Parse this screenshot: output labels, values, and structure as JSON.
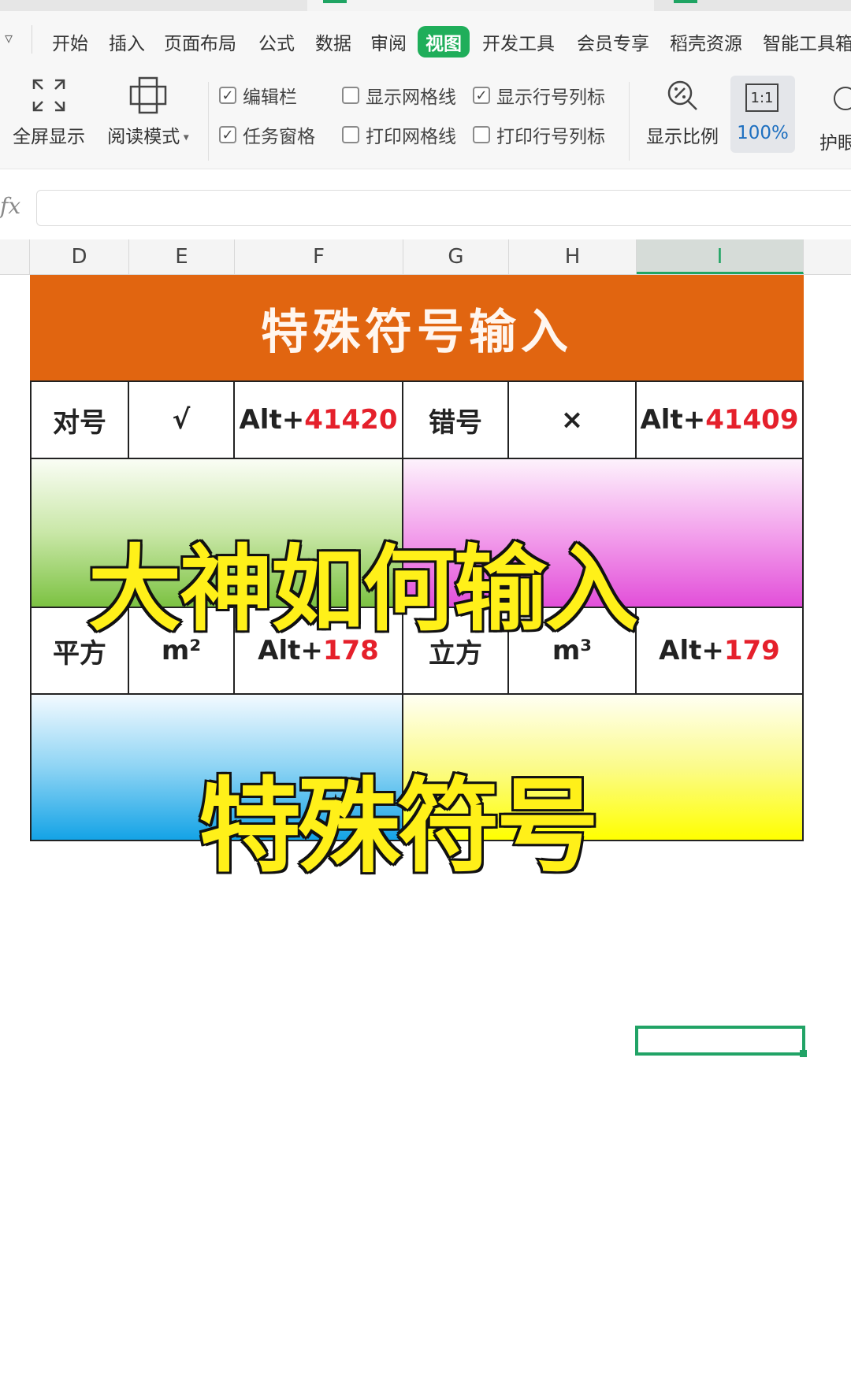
{
  "menu": {
    "items": [
      "开始",
      "插入",
      "页面布局",
      "公式",
      "数据",
      "审阅",
      "视图",
      "开发工具",
      "会员专享",
      "稻壳资源",
      "智能工具箱"
    ],
    "active": "视图",
    "active_color": "#1fae5a"
  },
  "toolbar": {
    "fullscreen_label": "全屏显示",
    "reading_mode_label": "阅读模式",
    "edit_bar": {
      "label": "编辑栏",
      "checked": true
    },
    "task_pane": {
      "label": "任务窗格",
      "checked": true
    },
    "show_gridlines": {
      "label": "显示网格线",
      "checked": false
    },
    "print_gridlines": {
      "label": "打印网格线",
      "checked": false
    },
    "show_headers": {
      "label": "显示行号列标",
      "checked": true
    },
    "print_headers": {
      "label": "打印行号列标",
      "checked": false
    },
    "zoom_label": "显示比例",
    "zoom_value": "100%",
    "one_to_one_glyph": "1:1",
    "eye_label": "护眼"
  },
  "formula_bar": {
    "fx_label": "fx",
    "value": ""
  },
  "columns": [
    "D",
    "E",
    "F",
    "G",
    "H",
    "I"
  ],
  "selected_column": "I",
  "sheet": {
    "banner_title": "特殊符号输入",
    "banner_color": "#e16510",
    "row1": {
      "name1": "对号",
      "symbol1": "√",
      "code1_prefix": "Alt+",
      "code1_num": "41420",
      "name2": "错号",
      "symbol2": "×",
      "code2_prefix": "Alt+",
      "code2_num": "41409"
    },
    "row2": {
      "name1": "平方",
      "symbol1": "m²",
      "code1_prefix": "Alt+",
      "code1_num": "178",
      "name2": "立方",
      "symbol2": "m³",
      "code2_prefix": "Alt+",
      "code2_num": "179"
    },
    "code_number_color": "#e5202b"
  },
  "captions": {
    "line1": "大神如何输入",
    "line2": "特殊符号",
    "color": "#fff019"
  }
}
